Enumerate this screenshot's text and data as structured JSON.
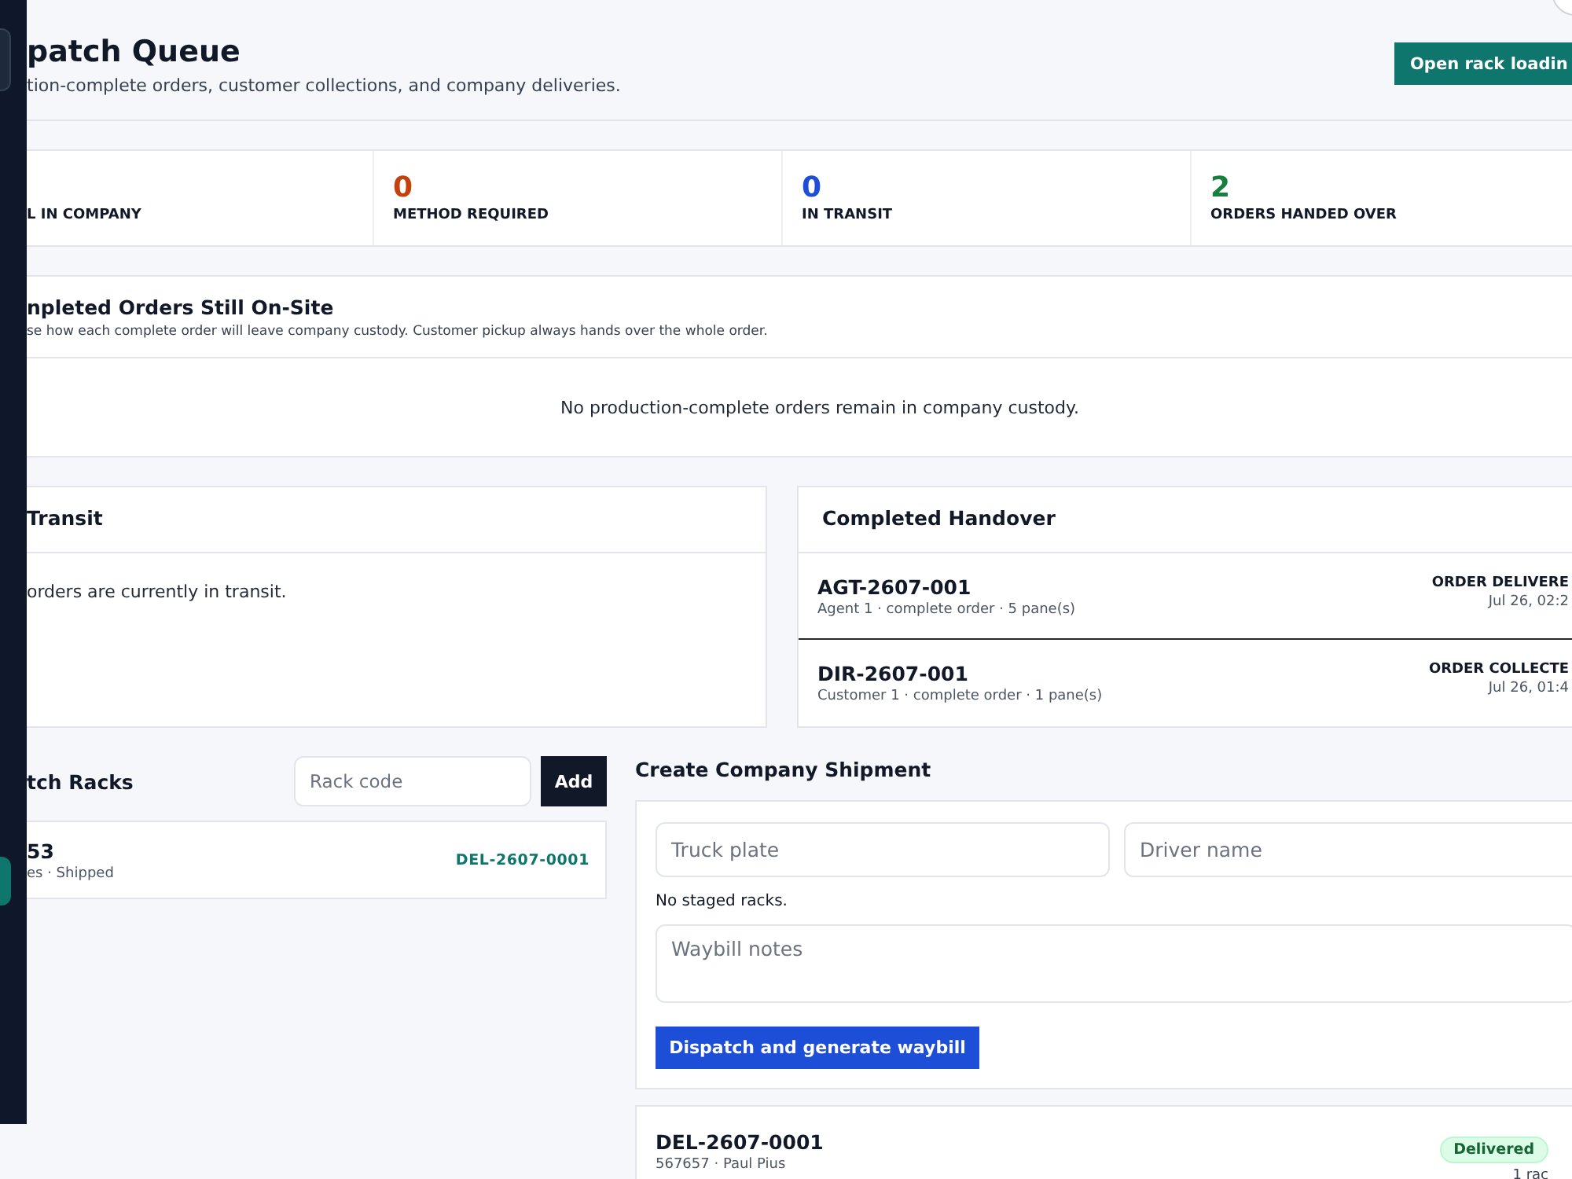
{
  "header": {
    "title": "patch Queue",
    "subtitle": "tion-complete orders, customer collections, and company deliveries.",
    "action": "Open rack loadin"
  },
  "sidebar": {
    "items": [
      {
        "selected": false
      },
      {
        "selected": true
      }
    ]
  },
  "stats": [
    {
      "label": "L IN COMPANY"
    },
    {
      "value": "0",
      "label": "METHOD REQUIRED",
      "kind": "warning"
    },
    {
      "value": "0",
      "label": "IN TRANSIT",
      "kind": "info"
    },
    {
      "value": "2",
      "label": "ORDERS HANDED OVER",
      "kind": "success"
    }
  ],
  "on_site": {
    "title": "npleted Orders Still On-Site",
    "description": "se how each complete order will leave company custody. Customer pickup always hands over the whole order.",
    "empty": "No production-complete orders remain in company custody."
  },
  "in_transit": {
    "title": "Transit",
    "empty": "orders are currently in transit."
  },
  "handover": {
    "title": "Completed Handover",
    "rows": [
      {
        "code": "AGT-2607-001",
        "detail": "Agent 1 · complete order · 5 pane(s)",
        "status": "ORDER DELIVERE",
        "time": "Jul 26, 02:2",
        "selected": true
      },
      {
        "code": "DIR-2607-001",
        "detail": "Customer 1 · complete order · 1 pane(s)",
        "status": "ORDER COLLECTE",
        "time": "Jul 26, 01:4",
        "selected": false
      }
    ]
  },
  "racks": {
    "title": "tch Racks",
    "field": {
      "placeholder": "Rack code"
    },
    "add": "Add",
    "items": [
      {
        "code": "53",
        "detail": "es · Shipped",
        "shipment": "DEL-2607-0001"
      }
    ]
  },
  "shipment": {
    "title": "Create Company Shipment",
    "truck": {
      "placeholder": "Truck plate"
    },
    "driver": {
      "placeholder": "Driver name"
    },
    "note": "No staged racks.",
    "notes": {
      "placeholder": "Waybill notes"
    },
    "submit": "Dispatch and generate waybill"
  },
  "deliveries": [
    {
      "code": "DEL-2607-0001",
      "detail": "567657 · Paul Pius",
      "status": "Delivered",
      "count": "1 rac"
    }
  ]
}
